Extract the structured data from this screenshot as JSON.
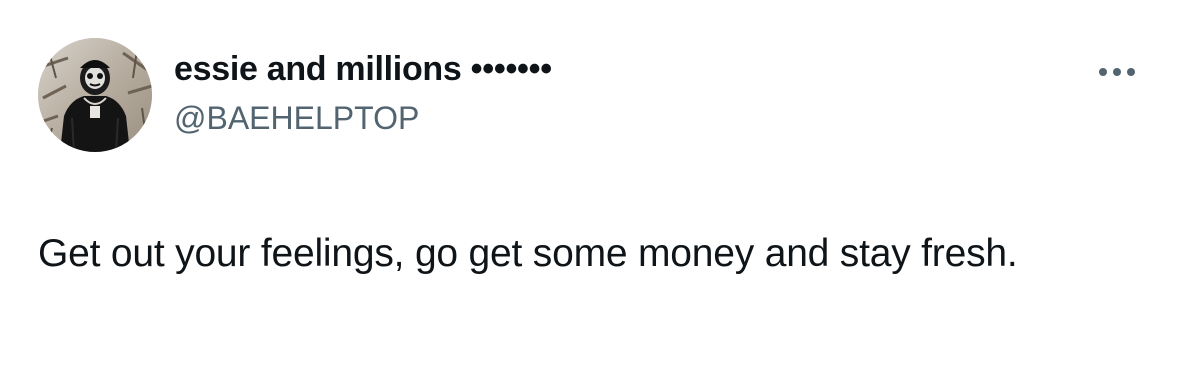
{
  "tweet": {
    "author": {
      "display_name": "essie and millions •••••••",
      "handle": "@BAEHELPTOP",
      "avatar_icon": "profile-photo"
    },
    "more_icon": "more-horizontal-icon",
    "text": "Get out your feelings, go get some money and stay fresh."
  },
  "colors": {
    "text_primary": "#0f1419",
    "text_secondary": "#536471",
    "background": "#ffffff"
  }
}
